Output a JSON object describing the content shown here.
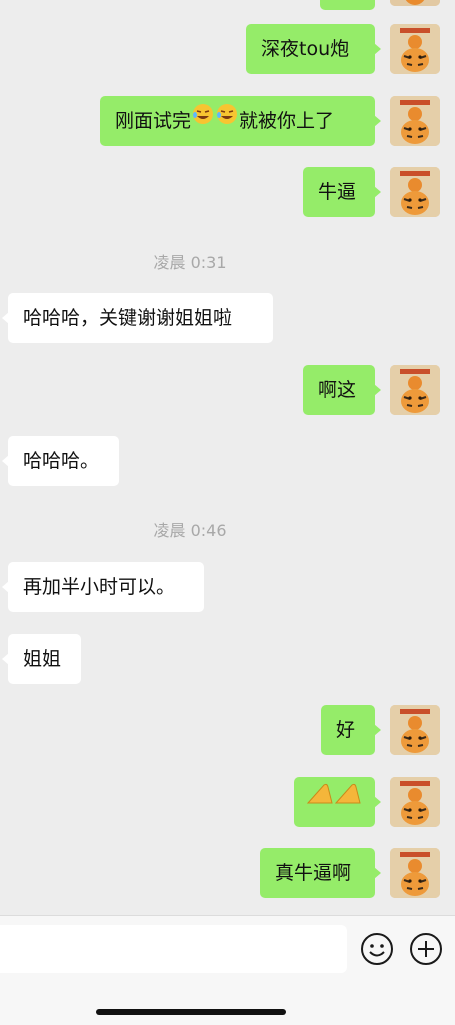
{
  "messages": [
    {
      "dir": "out",
      "text": "深夜tou炮"
    },
    {
      "dir": "out",
      "text_before": "刚面试完",
      "emoji_count": 2,
      "text_after": "就被你上了"
    },
    {
      "dir": "out",
      "text": "牛逼"
    },
    {
      "time": "凌晨 0:31"
    },
    {
      "dir": "in",
      "text": "哈哈哈，关键谢谢姐姐啦"
    },
    {
      "dir": "out",
      "text": "啊这"
    },
    {
      "dir": "in",
      "text": "哈哈哈。"
    },
    {
      "time": "凌晨 0:46"
    },
    {
      "dir": "in",
      "text": "再加半小时可以。"
    },
    {
      "dir": "in",
      "text": "姐姐"
    },
    {
      "dir": "out",
      "text": "好"
    },
    {
      "dir": "out",
      "emoji": "pray-hands-icon"
    },
    {
      "dir": "out",
      "text": "真牛逼啊"
    }
  ],
  "avatar": {
    "icon": "tiger-sticker-avatar"
  },
  "input_bar": {
    "emoji_button_icon": "emoji-face-icon",
    "more_button_icon": "plus-circle-icon"
  },
  "colors": {
    "outgoing_bubble": "#95ec69",
    "incoming_bubble": "#ffffff",
    "chat_background": "#ededed",
    "timestamp": "#a8a8a8"
  }
}
